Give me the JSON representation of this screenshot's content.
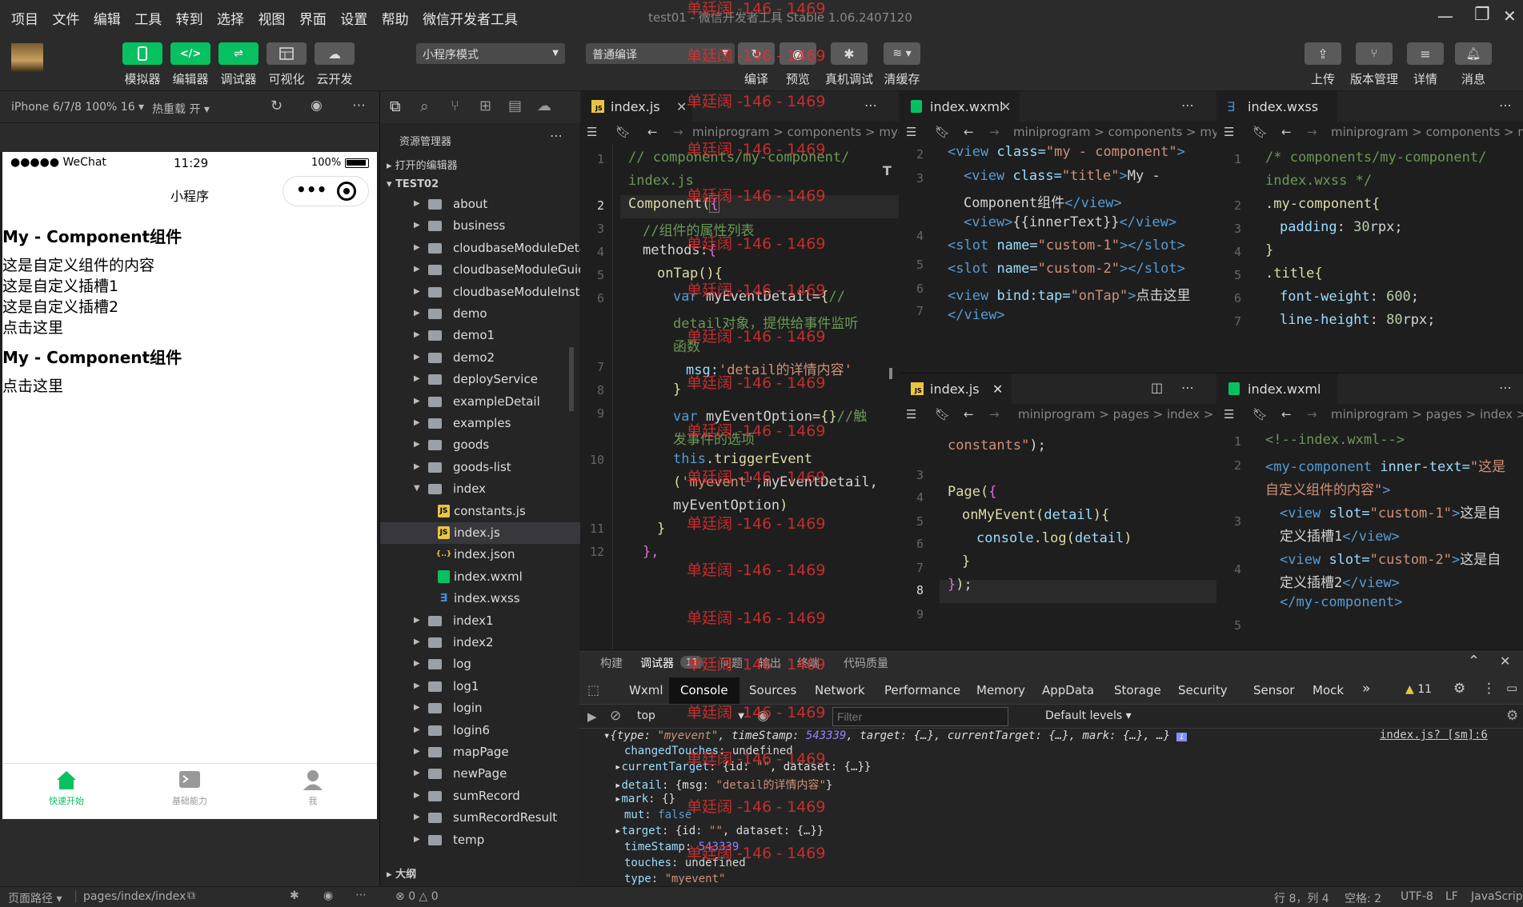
{
  "menu": [
    "项目",
    "文件",
    "编辑",
    "工具",
    "转到",
    "选择",
    "视图",
    "界面",
    "设置",
    "帮助",
    "微信开发者工具"
  ],
  "window_title": "test01 - 微信开发者工具 Stable 1.06.2407120",
  "toolbar": {
    "simulator": "模拟器",
    "editor": "编辑器",
    "debugger": "调试器",
    "visual": "可视化",
    "cloud": "云开发",
    "mode": "小程序模式",
    "compile_mode": "普通编译",
    "compile": "编译",
    "preview": "预览",
    "remote_debug": "真机调试",
    "clear_cache": "清缓存",
    "upload": "上传",
    "version": "版本管理",
    "details": "详情",
    "messages": "消息"
  },
  "simulator": {
    "device": "iPhone 6/7/8 100% 16",
    "hot_reload": "热重载 开",
    "status_carrier": "●●●●● WeChat",
    "status_time": "11:29",
    "status_battery": "100%",
    "nav_title": "小程序",
    "content": [
      {
        "text": "My - Component组件",
        "bold": true
      },
      {
        "text": "这是自定义组件的内容",
        "bold": false
      },
      {
        "text": "这是自定义插槽1",
        "bold": false
      },
      {
        "text": "这是自定义插槽2",
        "bold": false
      },
      {
        "text": "点击这里",
        "bold": false
      },
      {
        "text": "My - Component组件",
        "bold": true
      },
      {
        "text": "点击这里",
        "bold": false
      }
    ],
    "tabbar": [
      "快速开始",
      "基础能力",
      "我"
    ]
  },
  "statusbar": {
    "page_path_label": "页面路径",
    "page_path": "pages/index/index",
    "errors": "0",
    "warnings": "0",
    "position": "行 8，列 4",
    "spaces": "空格: 2",
    "encoding": "UTF-8",
    "eol": "LF",
    "language": "JavaScript"
  },
  "explorer": {
    "title": "资源管理器",
    "open_editors": "打开的编辑器",
    "project": "TEST02",
    "outline": "大纲",
    "items": [
      {
        "name": "about",
        "type": "folder",
        "depth": 1
      },
      {
        "name": "business",
        "type": "folder",
        "depth": 1
      },
      {
        "name": "cloudbaseModuleDetail",
        "type": "folder",
        "depth": 1
      },
      {
        "name": "cloudbaseModuleGuide",
        "type": "folder",
        "depth": 1
      },
      {
        "name": "cloudbaseModuleInst...",
        "type": "folder",
        "depth": 1
      },
      {
        "name": "demo",
        "type": "folder",
        "depth": 1
      },
      {
        "name": "demo1",
        "type": "folder",
        "depth": 1
      },
      {
        "name": "demo2",
        "type": "folder",
        "depth": 1
      },
      {
        "name": "deployService",
        "type": "folder",
        "depth": 1
      },
      {
        "name": "exampleDetail",
        "type": "folder",
        "depth": 1
      },
      {
        "name": "examples",
        "type": "folder",
        "depth": 1
      },
      {
        "name": "goods",
        "type": "folder",
        "depth": 1
      },
      {
        "name": "goods-list",
        "type": "folder",
        "depth": 1
      },
      {
        "name": "index",
        "type": "folder-open",
        "depth": 1
      },
      {
        "name": "constants.js",
        "type": "js",
        "depth": 2
      },
      {
        "name": "index.js",
        "type": "js",
        "depth": 2
      },
      {
        "name": "index.json",
        "type": "json",
        "depth": 2
      },
      {
        "name": "index.wxml",
        "type": "wxml",
        "depth": 2
      },
      {
        "name": "index.wxss",
        "type": "wxss",
        "depth": 2
      },
      {
        "name": "index1",
        "type": "folder",
        "depth": 1
      },
      {
        "name": "index2",
        "type": "folder",
        "depth": 1
      },
      {
        "name": "log",
        "type": "folder",
        "depth": 1
      },
      {
        "name": "log1",
        "type": "folder",
        "depth": 1
      },
      {
        "name": "login",
        "type": "folder",
        "depth": 1
      },
      {
        "name": "login6",
        "type": "folder",
        "depth": 1
      },
      {
        "name": "mapPage",
        "type": "folder",
        "depth": 1
      },
      {
        "name": "newPage",
        "type": "folder",
        "depth": 1
      },
      {
        "name": "sumRecord",
        "type": "folder",
        "depth": 1
      },
      {
        "name": "sumRecordResult",
        "type": "folder",
        "depth": 1
      },
      {
        "name": "temp",
        "type": "folder",
        "depth": 1
      }
    ]
  },
  "editors": {
    "e1": {
      "tab": "index.js",
      "bread": "miniprogram  >  components  >  my-compo"
    },
    "e2": {
      "tab": "index.wxml",
      "bread": "miniprogram  >  components  >  my-c"
    },
    "e3": {
      "tab": "index.wxss",
      "bread": "miniprogram  >  components  >  my"
    },
    "e4": {
      "tab": "index.js",
      "bread": "miniprogram  >  pages  >  index  >"
    },
    "e5": {
      "tab": "index.wxml",
      "bread": "miniprogram  >  pages  >  index  >"
    }
  },
  "watermark": "单廷阔 -146 - 1469",
  "devtools": {
    "tabs": [
      "构建",
      "调试器",
      "问题",
      "输出",
      "终端",
      "代码质量"
    ],
    "debugger_count": "11",
    "panels": [
      "Wxml",
      "Console",
      "Sources",
      "Network",
      "Performance",
      "Memory",
      "AppData",
      "Storage",
      "Security",
      "Sensor",
      "Mock"
    ],
    "warn_count": "11",
    "context": "top",
    "filter_placeholder": "Filter",
    "levels": "Default levels",
    "source_link": "index.js? [sm]:6"
  }
}
